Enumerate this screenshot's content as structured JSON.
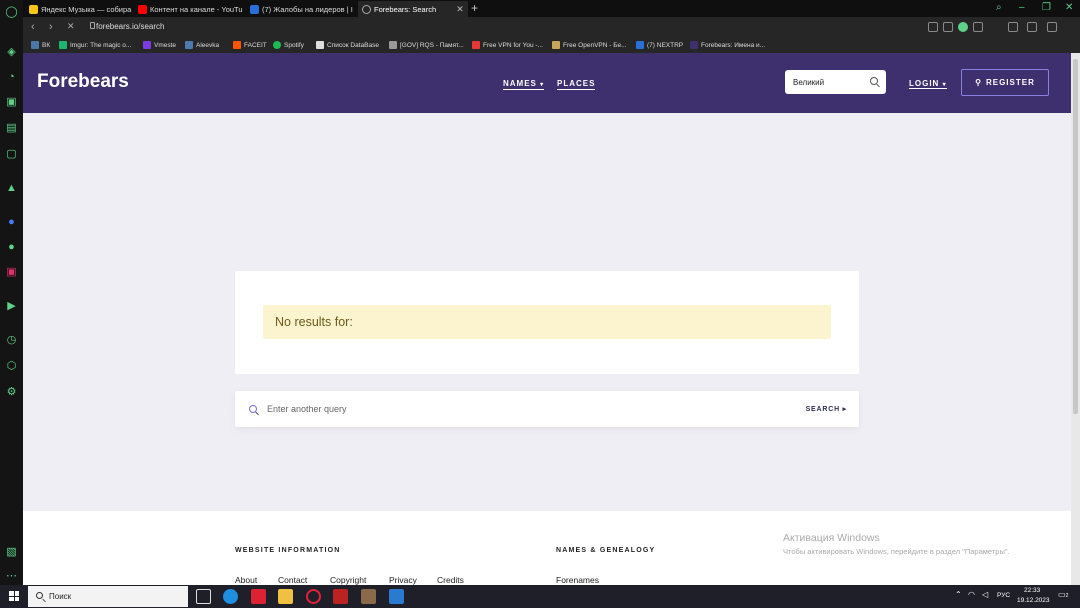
{
  "browser": {
    "tabs": [
      {
        "label": "Яндекс Музыка — собира",
        "color": "#f5c518"
      },
      {
        "label": "Контент на канале - YouTu",
        "color": "#ff0000"
      },
      {
        "label": "(7) Жалобы на лидеров | I",
        "color": "#2a6fd6"
      },
      {
        "label": "Forebears: Search",
        "color": "#888888"
      }
    ],
    "new_tab": "+",
    "url": "forebears.io/search",
    "bookmarks": [
      {
        "label": "ВК",
        "color": "#4a76a8"
      },
      {
        "label": "Imgur: The magic o...",
        "color": "#1bb76e"
      },
      {
        "label": "Vmeste",
        "color": "#7a3de0"
      },
      {
        "label": "Aleevka",
        "color": "#4b7bb0"
      },
      {
        "label": "FACEIT",
        "color": "#ff5500"
      },
      {
        "label": "Spotify",
        "color": "#1db954"
      },
      {
        "label": "Список DataBase",
        "color": "#dddddd"
      },
      {
        "label": "[GOV] RQS - Памят...",
        "color": "#999999"
      },
      {
        "label": "Free VPN for You -...",
        "color": "#e53935"
      },
      {
        "label": "Free OpenVPN - Бе...",
        "color": "#c8a45a"
      },
      {
        "label": "(7) NEXTRP",
        "color": "#2a6fd6"
      },
      {
        "label": "Forebears: Имена и...",
        "color": "#3e2f6f"
      }
    ]
  },
  "site": {
    "logo": "Forebears",
    "nav": {
      "names": "NAMES",
      "places": "PLACES"
    },
    "search_value": "Великий",
    "login": "LOGIN",
    "register": "REGISTER",
    "no_results": "No results for:",
    "query_placeholder": "Enter another query",
    "search_button": "SEARCH",
    "footer": {
      "website_info": "WEBSITE INFORMATION",
      "names_genealogy": "NAMES & GENEALOGY",
      "links": [
        "About",
        "Contact",
        "Copyright",
        "Privacy",
        "Credits"
      ],
      "forenames": "Forenames"
    },
    "activation": {
      "title": "Активация Windows",
      "subtitle": "Чтобы активировать Windows, перейдите в раздел \"Параметры\"."
    }
  },
  "taskbar": {
    "search": "Поиск",
    "lang": "РУС",
    "time": "22:33",
    "date": "19.12.2023",
    "notifications": "2"
  }
}
